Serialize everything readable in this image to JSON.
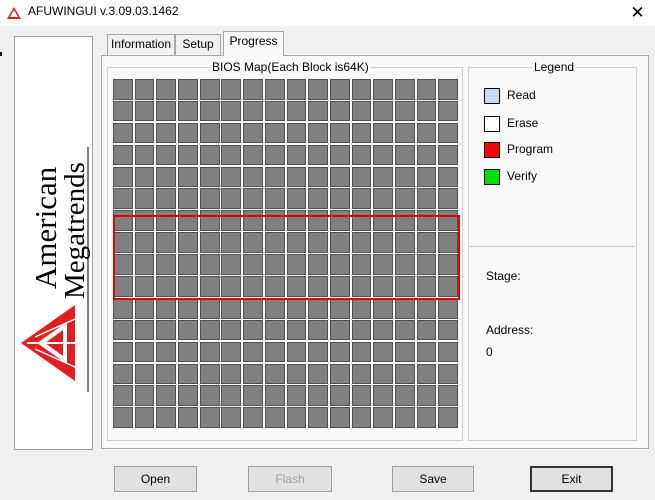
{
  "window": {
    "title": "AFUWINGUI v.3.09.03.1462",
    "close_glyph": "✕"
  },
  "logo": {
    "line1": "American",
    "line2": "Megatrends",
    "icon": "ami-logo-icon",
    "accent": "#e02020"
  },
  "tabs": [
    {
      "label": "Information",
      "active": false
    },
    {
      "label": "Setup",
      "active": false
    },
    {
      "label": "Progress",
      "active": true
    }
  ],
  "bios_map": {
    "title": "BIOS Map(Each Block is64K)",
    "rows": 16,
    "cols": 16,
    "block_color": "#808080",
    "highlight_color": "#e00000"
  },
  "legend": {
    "title": "Legend",
    "items": [
      {
        "label": "Read",
        "color": "#c8dcf0"
      },
      {
        "label": "Erase",
        "color": "#ffffff"
      },
      {
        "label": "Program",
        "color": "#ff0000"
      },
      {
        "label": "Verify",
        "color": "#00e000"
      }
    ]
  },
  "status": {
    "stage_label": "Stage:",
    "stage_value": "",
    "address_label": "Address:",
    "address_value": "0"
  },
  "buttons": {
    "open": "Open",
    "flash": "Flash",
    "save": "Save",
    "exit": "Exit"
  }
}
